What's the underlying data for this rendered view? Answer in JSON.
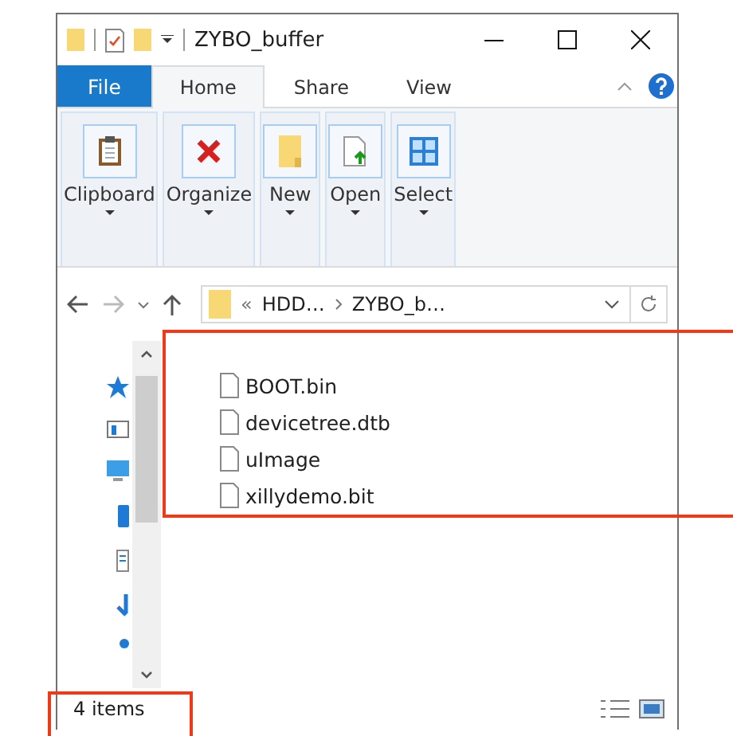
{
  "window": {
    "title": "ZYBO_buffer"
  },
  "tabs": [
    {
      "label": "File",
      "kind": "file",
      "selected": false
    },
    {
      "label": "Home",
      "kind": "tab",
      "selected": true
    },
    {
      "label": "Share",
      "kind": "tab",
      "selected": false
    },
    {
      "label": "View",
      "kind": "tab",
      "selected": false
    }
  ],
  "ribbon": {
    "groups": [
      {
        "label": "Clipboard",
        "kind": "clipboard"
      },
      {
        "label": "Organize",
        "kind": "delete"
      },
      {
        "label": "New",
        "kind": "folder"
      },
      {
        "label": "Open",
        "kind": "document"
      },
      {
        "label": "Select",
        "kind": "grid"
      }
    ]
  },
  "address": {
    "overflow": "«",
    "segments": [
      "HDD…",
      "ZYBO_b…"
    ]
  },
  "files": [
    "BOOT.bin",
    "devicetree.dtb",
    "uImage",
    "xillydemo.bit"
  ],
  "status_bar": {
    "count": "4 items"
  }
}
